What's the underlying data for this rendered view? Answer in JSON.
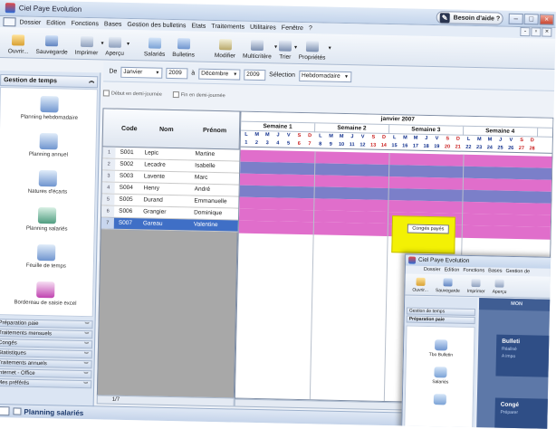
{
  "window": {
    "title": "Ciel Paye Evolution",
    "help_label": "Besoin d'aide ?"
  },
  "menu": [
    "Dossier",
    "Edition",
    "Fonctions",
    "Bases",
    "Gestion des bulletins",
    "Etats",
    "Traitements",
    "Utilitaires",
    "Fenêtre",
    "?"
  ],
  "toolbar": [
    {
      "label": "Ouvrir...",
      "icon": "open-folder-icon",
      "dropdown": false
    },
    {
      "label": "Sauvegarde",
      "icon": "save-icon",
      "dropdown": false
    },
    {
      "label": "Imprimer",
      "icon": "printer-icon",
      "dropdown": true
    },
    {
      "label": "Aperçu",
      "icon": "preview-icon",
      "dropdown": true
    },
    {
      "label": "Salariés",
      "icon": "employees-icon",
      "dropdown": false
    },
    {
      "label": "Bulletins",
      "icon": "payslip-icon",
      "dropdown": false
    },
    {
      "label": "Modifier",
      "icon": "edit-icon",
      "dropdown": false
    },
    {
      "label": "Multicritère",
      "icon": "search-icon",
      "dropdown": true
    },
    {
      "label": "Trier",
      "icon": "sort-icon",
      "dropdown": true
    },
    {
      "label": "Propriétés",
      "icon": "properties-icon",
      "dropdown": true
    }
  ],
  "sidebar": {
    "group_title": "Gestion de temps",
    "items": [
      {
        "label": "Planning hebdomadaire",
        "icon": "weekly-planning-icon"
      },
      {
        "label": "Planning annuel",
        "icon": "annual-planning-icon"
      },
      {
        "label": "Natures d'écarts",
        "icon": "gap-types-icon"
      },
      {
        "label": "Planning salariés",
        "icon": "staff-planning-icon"
      },
      {
        "label": "Feuille de temps",
        "icon": "timesheet-icon"
      },
      {
        "label": "Bordereau de saisie excel",
        "icon": "excel-entry-icon"
      }
    ],
    "tabs": [
      "Préparation paie",
      "Traitements mensuels",
      "Congés",
      "Statistiques",
      "Traitements annuels",
      "Internet - Office",
      "Mes préférés"
    ]
  },
  "filter": {
    "de_label": "De",
    "from_month": "Janvier",
    "from_year": "2009",
    "a_label": "à",
    "to_month": "Décembre",
    "to_year": "2009",
    "selection_label": "Sélection",
    "selection_value": "Hebdomadaire",
    "check1": "Début en demi-journée",
    "check2": "Fin en demi-journée"
  },
  "grid": {
    "headers": {
      "code": "Code",
      "nom": "Nom",
      "prenom": "Prénom"
    },
    "rows": [
      {
        "n": "1",
        "code": "S001",
        "nom": "Lepic",
        "prenom": "Martine"
      },
      {
        "n": "2",
        "code": "S002",
        "nom": "Lecadre",
        "prenom": "Isabelle"
      },
      {
        "n": "3",
        "code": "S003",
        "nom": "Lavente",
        "prenom": "Marc"
      },
      {
        "n": "4",
        "code": "S004",
        "nom": "Henry",
        "prenom": "André"
      },
      {
        "n": "5",
        "code": "S005",
        "nom": "Durand",
        "prenom": "Emmanuelle"
      },
      {
        "n": "6",
        "code": "S006",
        "nom": "Grangier",
        "prenom": "Dominique"
      },
      {
        "n": "7",
        "code": "S007",
        "nom": "Gareau",
        "prenom": "Valentine"
      }
    ],
    "footer": "1/7"
  },
  "calendar": {
    "month": "janvier 2007",
    "weeks": [
      "Semaine 1",
      "Semaine 2",
      "Semaine 3",
      "Semaine 4"
    ],
    "day_letters": [
      "L",
      "M",
      "M",
      "J",
      "V",
      "S",
      "D",
      "L",
      "M",
      "M",
      "J",
      "V",
      "S",
      "D",
      "L",
      "M",
      "M",
      "J",
      "V",
      "S",
      "D",
      "L",
      "M",
      "M",
      "J",
      "V",
      "S",
      "D"
    ],
    "day_numbers": [
      "1",
      "2",
      "3",
      "4",
      "5",
      "6",
      "7",
      "8",
      "9",
      "10",
      "11",
      "12",
      "13",
      "14",
      "15",
      "16",
      "17",
      "18",
      "19",
      "20",
      "21",
      "22",
      "23",
      "24",
      "25",
      "26",
      "27",
      "28"
    ],
    "row_colors": [
      "#e06ecb",
      "#7b7fc9",
      "#e06ecb",
      "#7b7fc9",
      "#e06ecb",
      "#e06ecb",
      "#e06ecb"
    ],
    "leave_label": "Congés payés",
    "leave_color": "#f3f104"
  },
  "status": {
    "title": "Planning salariés"
  },
  "inset": {
    "title": "Ciel Paye Evolution",
    "menu": [
      "Dossier",
      "Edition",
      "Fonctions",
      "Bases",
      "Gestion de"
    ],
    "toolbar": [
      "Ouvrir...",
      "Sauvegarde",
      "Imprimer",
      "Aperçu"
    ],
    "tabs": [
      "Gestion de temps",
      "Préparation paie"
    ],
    "items": [
      "Tbo Bulletin",
      "Salariés"
    ],
    "main_header": "MON",
    "card1_title": "Bulleti",
    "card1_sub1": "Réalisé",
    "card1_sub2": "A impo",
    "card2_title": "Congé",
    "card2_sub": "Préparer"
  }
}
